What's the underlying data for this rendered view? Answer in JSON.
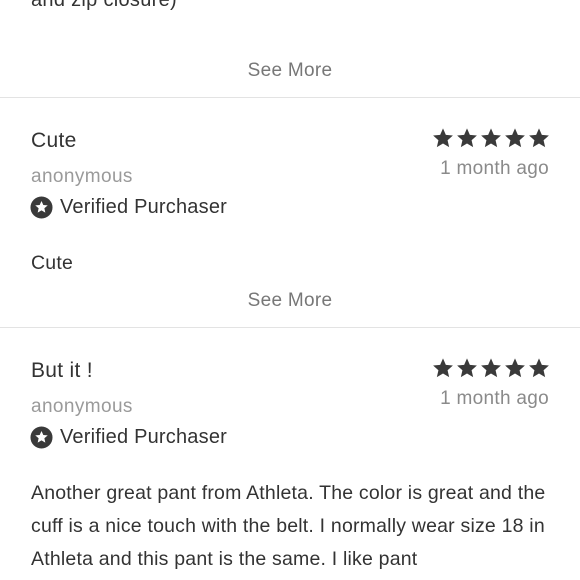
{
  "previous_review": {
    "tail_text": "and zip closure)",
    "see_more_label": "See More"
  },
  "reviews": [
    {
      "title": "Cute",
      "rating": 5,
      "date": "1 month ago",
      "author": "anonymous",
      "verified_label": "Verified Purchaser",
      "body": "Cute",
      "see_more_label": "See More"
    },
    {
      "title": "But it !",
      "rating": 5,
      "date": "1 month ago",
      "author": "anonymous",
      "verified_label": "Verified Purchaser",
      "body": "Another great pant from Athleta.  The color is great and the cuff is a nice touch with the belt.  I normally wear size 18 in Athleta and this pant is the same.  I like pant"
    }
  ],
  "colors": {
    "text": "#333333",
    "muted": "#8a8a8a",
    "divider": "#e3e3e3",
    "star": "#3a3a3a"
  },
  "icons": {
    "rating": "star-icon",
    "verified": "verified-star-badge-icon"
  }
}
